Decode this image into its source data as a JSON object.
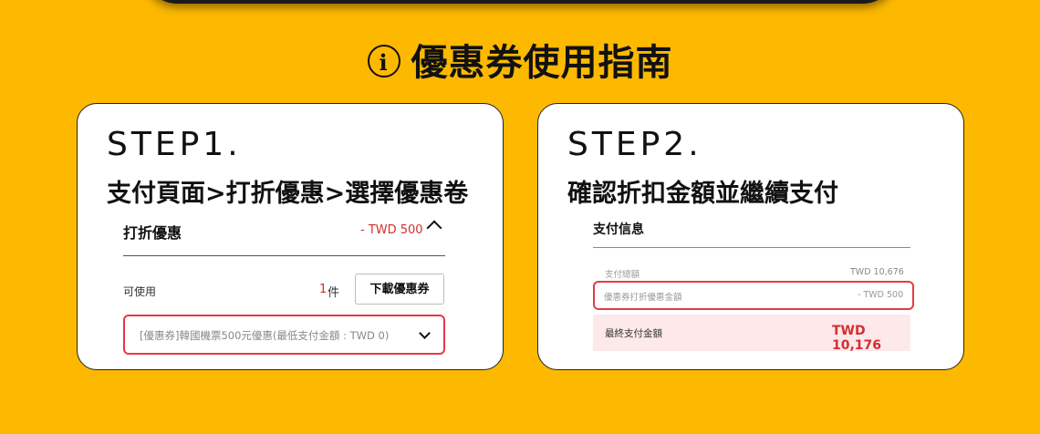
{
  "header": {
    "title": "優惠券使用指南",
    "icon_glyph": "i",
    "icon_name": "info-icon"
  },
  "colors": {
    "background": "#FDB900",
    "accent_red": "#e53945",
    "price_red": "#d32f2f"
  },
  "step1": {
    "step_label": "STEP1.",
    "subtitle": "支付頁面>打折優惠>選擇優惠卷",
    "discount_heading": "打折優惠",
    "discount_amount": "- TWD 500",
    "available_label": "可使用",
    "available_count": "1",
    "available_unit": "件",
    "download_button": "下載優惠券",
    "coupon_selected": "[優惠券]韓國機票500元優惠(最低支付金額 : TWD 0)",
    "expand_icon": "chevron-up-icon",
    "select_icon": "chevron-down-icon"
  },
  "step2": {
    "step_label": "STEP2.",
    "subtitle": "確認折扣金額並繼續支付",
    "payment_heading": "支付信息",
    "total_label": "支付總額",
    "total_value": "TWD 10,676",
    "coupon_label": "優惠券打折優惠金額",
    "coupon_value": "- TWD 500",
    "final_label": "最終支付金額",
    "final_value": "TWD 10,176"
  }
}
